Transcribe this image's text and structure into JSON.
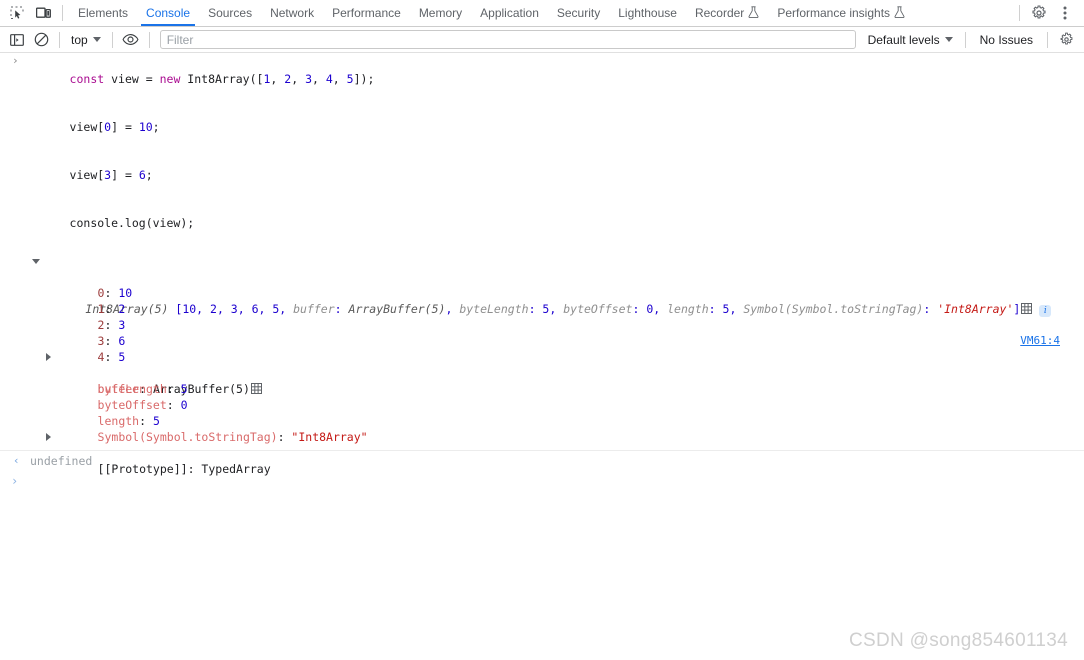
{
  "tabbar": {
    "icons": [
      {
        "name": "inspect-element-icon",
        "title": "Inspect element"
      },
      {
        "name": "device-toolbar-icon",
        "title": "Toggle device toolbar"
      }
    ],
    "tabs": [
      {
        "label": "Elements",
        "active": false,
        "flask": false
      },
      {
        "label": "Console",
        "active": true,
        "flask": false
      },
      {
        "label": "Sources",
        "active": false,
        "flask": false
      },
      {
        "label": "Network",
        "active": false,
        "flask": false
      },
      {
        "label": "Performance",
        "active": false,
        "flask": false
      },
      {
        "label": "Memory",
        "active": false,
        "flask": false
      },
      {
        "label": "Application",
        "active": false,
        "flask": false
      },
      {
        "label": "Security",
        "active": false,
        "flask": false
      },
      {
        "label": "Lighthouse",
        "active": false,
        "flask": false
      },
      {
        "label": "Recorder",
        "active": false,
        "flask": true
      },
      {
        "label": "Performance insights",
        "active": false,
        "flask": true
      }
    ],
    "settings_icon": "gear-icon",
    "more_icon": "more-vertical-icon"
  },
  "filterbar": {
    "sidebar_icon": "console-sidebar-icon",
    "clear_icon": "clear-console-icon",
    "context": "top",
    "eye_icon": "live-expression-eye-icon",
    "filter_placeholder": "Filter",
    "filter_value": "",
    "levels": "Default levels",
    "issues": "No Issues",
    "settings_icon": "console-settings-gear-icon"
  },
  "console": {
    "input_lines": [
      [
        {
          "t": "const",
          "c": "kw"
        },
        {
          "t": " view ",
          "c": "plain"
        },
        {
          "t": "=",
          "c": "plain"
        },
        {
          "t": " ",
          "c": "plain"
        },
        {
          "t": "new",
          "c": "kw"
        },
        {
          "t": " Int8Array([",
          "c": "plain"
        },
        {
          "t": "1",
          "c": "num"
        },
        {
          "t": ", ",
          "c": "plain"
        },
        {
          "t": "2",
          "c": "num"
        },
        {
          "t": ", ",
          "c": "plain"
        },
        {
          "t": "3",
          "c": "num"
        },
        {
          "t": ", ",
          "c": "plain"
        },
        {
          "t": "4",
          "c": "num"
        },
        {
          "t": ", ",
          "c": "plain"
        },
        {
          "t": "5",
          "c": "num"
        },
        {
          "t": "]);",
          "c": "plain"
        }
      ],
      [
        {
          "t": "view[",
          "c": "plain"
        },
        {
          "t": "0",
          "c": "num"
        },
        {
          "t": "] = ",
          "c": "plain"
        },
        {
          "t": "10",
          "c": "num"
        },
        {
          "t": ";",
          "c": "plain"
        }
      ],
      [
        {
          "t": "view[",
          "c": "plain"
        },
        {
          "t": "3",
          "c": "num"
        },
        {
          "t": "] = ",
          "c": "plain"
        },
        {
          "t": "6",
          "c": "num"
        },
        {
          "t": ";",
          "c": "plain"
        }
      ],
      [
        {
          "t": "console.log(view);",
          "c": "plain"
        }
      ]
    ],
    "prompt_symbol": "›",
    "result": {
      "constructor": "Int8Array(5)",
      "preview": " [10, 2, 3, 6, 5, ",
      "preview_parts": [
        {
          "t": "Int8Array(5)",
          "c": "obj-name"
        },
        {
          "t": " [10, 2, 3, 6, 5, ",
          "c": "obj-val"
        },
        {
          "t": "buffer",
          "c": "obj-key-dim"
        },
        {
          "t": ": ",
          "c": "obj-val"
        },
        {
          "t": "ArrayBuffer(5)",
          "c": "obj-name"
        },
        {
          "t": ", ",
          "c": "obj-val"
        },
        {
          "t": "byteLength",
          "c": "obj-key-dim"
        },
        {
          "t": ": ",
          "c": "obj-val"
        },
        {
          "t": "5",
          "c": "obj-val"
        },
        {
          "t": ", ",
          "c": "obj-val"
        },
        {
          "t": "byteOffset",
          "c": "obj-key-dim"
        },
        {
          "t": ": ",
          "c": "obj-val"
        },
        {
          "t": "0",
          "c": "obj-val"
        },
        {
          "t": ", ",
          "c": "obj-val"
        },
        {
          "t": "length",
          "c": "obj-key-dim"
        },
        {
          "t": ": ",
          "c": "obj-val"
        },
        {
          "t": "5",
          "c": "obj-val"
        },
        {
          "t": ", ",
          "c": "obj-val"
        },
        {
          "t": "Symbol(Symbol.toStringTag)",
          "c": "obj-key-dim"
        },
        {
          "t": ": ",
          "c": "obj-val"
        },
        {
          "t": "'Int8Array'",
          "c": "obj-str"
        },
        {
          "t": "]",
          "c": "obj-val"
        }
      ],
      "grid_icon": "table-grid-icon",
      "info_badge": "i",
      "source_link": "VM61:4"
    },
    "properties": [
      {
        "key": "0",
        "sep": ": ",
        "value": "10",
        "key_class": "prop-idx",
        "val_class": "prop-num",
        "arrow": false
      },
      {
        "key": "1",
        "sep": ": ",
        "value": "2",
        "key_class": "prop-idx",
        "val_class": "prop-num",
        "arrow": false
      },
      {
        "key": "2",
        "sep": ": ",
        "value": "3",
        "key_class": "prop-idx",
        "val_class": "prop-num",
        "arrow": false
      },
      {
        "key": "3",
        "sep": ": ",
        "value": "6",
        "key_class": "prop-idx",
        "val_class": "prop-num",
        "arrow": false
      },
      {
        "key": "4",
        "sep": ": ",
        "value": "5",
        "key_class": "prop-idx",
        "val_class": "prop-num",
        "arrow": false
      },
      {
        "key": "buffer",
        "sep": ": ",
        "value": "ArrayBuffer(5)",
        "key_class": "prop-key",
        "val_class": "proto-val",
        "arrow": true,
        "grid": true
      },
      {
        "key": "byteLength",
        "sep": ": ",
        "value": "5",
        "key_class": "prop-key",
        "val_class": "prop-num",
        "arrow": false
      },
      {
        "key": "byteOffset",
        "sep": ": ",
        "value": "0",
        "key_class": "prop-key",
        "val_class": "prop-num",
        "arrow": false
      },
      {
        "key": "length",
        "sep": ": ",
        "value": "5",
        "key_class": "prop-key",
        "val_class": "prop-num",
        "arrow": false
      },
      {
        "key": "Symbol(Symbol.toStringTag)",
        "sep": ": ",
        "value": "\"Int8Array\"",
        "key_class": "prop-key",
        "val_class": "prop-str",
        "arrow": false
      },
      {
        "key": "[[Prototype]]",
        "sep": ": ",
        "value": "TypedArray",
        "key_class": "proto-key",
        "val_class": "proto-val",
        "arrow": true
      }
    ],
    "return_arrow": "‹",
    "return_value": "undefined",
    "new_prompt": "›"
  },
  "watermark": "CSDN @song854601134",
  "colors": {
    "accent": "#1a73e8",
    "keyword": "#aa0d91",
    "number": "#1c00cf",
    "string": "#c41a16",
    "prop_key": "#d96a6a",
    "muted": "#9aa0a6"
  }
}
